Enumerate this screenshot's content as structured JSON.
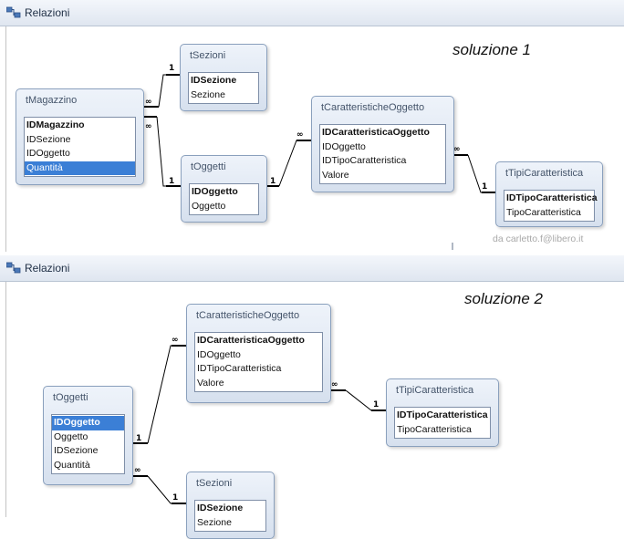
{
  "window_top": {
    "title": "Relazioni",
    "solution_label": "soluzione 1",
    "watermark": "da carletto.f@libero.it",
    "tables": {
      "tMagazzino": {
        "name": "tMagazzino",
        "fields": [
          "IDMagazzino",
          "IDSezione",
          "IDOggetto",
          "Quantità"
        ]
      },
      "tSezioni": {
        "name": "tSezioni",
        "fields": [
          "IDSezione",
          "Sezione"
        ]
      },
      "tOggetti": {
        "name": "tOggetti",
        "fields": [
          "IDOggetto",
          "Oggetto"
        ]
      },
      "tCaratteristicheOggetto": {
        "name": "tCaratteristicheOggetto",
        "fields": [
          "IDCaratteristicaOggetto",
          "IDOggetto",
          "IDTipoCaratteristica",
          "Valore"
        ]
      },
      "tTipiCaratteristica": {
        "name": "tTipiCaratteristica",
        "fields": [
          "IDTipoCaratteristica",
          "TipoCaratteristica"
        ]
      }
    },
    "relations": [
      {
        "from": "tMagazzino",
        "to": "tSezioni",
        "one_label": "1",
        "many_label": "∞"
      },
      {
        "from": "tMagazzino",
        "to": "tOggetti",
        "one_label": "1",
        "many_label": "∞"
      },
      {
        "from": "tOggetti",
        "to": "tCaratteristicheOggetto",
        "one_label": "1",
        "many_label": "∞"
      },
      {
        "from": "tCaratteristicheOggetto",
        "to": "tTipiCaratteristica",
        "one_label": "1",
        "many_label": "∞"
      }
    ]
  },
  "window_bottom": {
    "title": "Relazioni",
    "solution_label": "soluzione 2",
    "tables": {
      "tOggetti": {
        "name": "tOggetti",
        "fields": [
          "IDOggetto",
          "Oggetto",
          "IDSezione",
          "Quantità"
        ]
      },
      "tCaratteristicheOggetto": {
        "name": "tCaratteristicheOggetto",
        "fields": [
          "IDCaratteristicaOggetto",
          "IDOggetto",
          "IDTipoCaratteristica",
          "Valore"
        ]
      },
      "tTipiCaratteristica": {
        "name": "tTipiCaratteristica",
        "fields": [
          "IDTipoCaratteristica",
          "TipoCaratteristica"
        ]
      },
      "tSezioni": {
        "name": "tSezioni",
        "fields": [
          "IDSezione",
          "Sezione"
        ]
      }
    },
    "relations": [
      {
        "from": "tOggetti",
        "to": "tCaratteristicheOggetto",
        "one_label": "1",
        "many_label": "∞"
      },
      {
        "from": "tCaratteristicheOggetto",
        "to": "tTipiCaratteristica",
        "one_label": "1",
        "many_label": "∞"
      },
      {
        "from": "tOggetti",
        "to": "tSezioni",
        "one_label": "1",
        "many_label": "∞"
      }
    ]
  },
  "icons": {
    "window": "relationships-window-icon"
  },
  "colors": {
    "selection": "#3b7fd6",
    "title_text": "#1f2f45"
  }
}
